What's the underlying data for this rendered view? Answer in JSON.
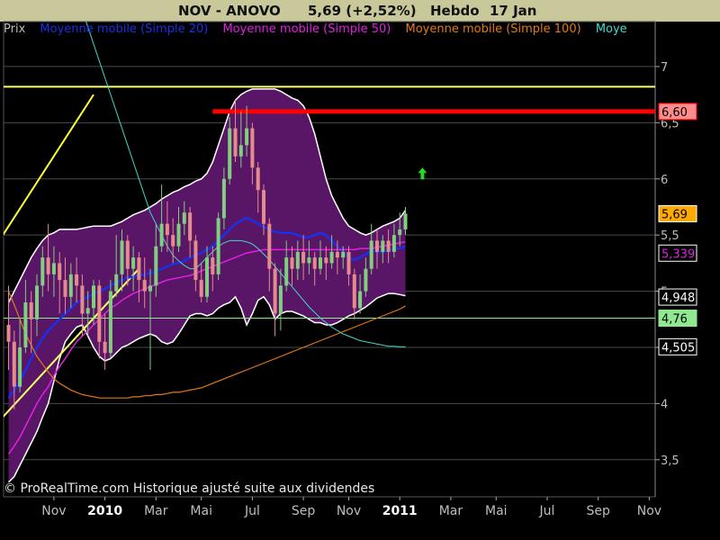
{
  "header": {
    "ticker": "NOV - ANOVO",
    "quote": "5,69 (+2,52%)",
    "period": "Hebdo",
    "date": "17 Jan"
  },
  "legend": [
    {
      "label": "Prix",
      "color": "#bdbdbd"
    },
    {
      "label": "Moyenne mobile (Simple 20)",
      "color": "#1a2fe6"
    },
    {
      "label": "Moyenne mobile (Simple 50)",
      "color": "#e020e0"
    },
    {
      "label": "Moyenne mobile (Simple 100)",
      "color": "#e07818"
    },
    {
      "label": "Moye",
      "color": "#40d8c8"
    }
  ],
  "footnote": "© ProRealTime.com Historique ajusté suite aux dividendes",
  "colors": {
    "background": "#000000",
    "title_bar": "#c8c89a",
    "band_fill": "#5a1666",
    "candle_up": "#7fcf7f",
    "candle_down": "#e48c8c",
    "resistance": "#ff0000",
    "trendline": "#ffff33",
    "support": "#90e890",
    "signal_arrow": "#22dd22"
  },
  "chart_data": {
    "type": "candlestick",
    "x_axis": {
      "labels": [
        {
          "label": "Nov",
          "index": 8,
          "bold": false
        },
        {
          "label": "2010",
          "index": 17,
          "bold": true
        },
        {
          "label": "Mar",
          "index": 26,
          "bold": false
        },
        {
          "label": "Mai",
          "index": 34,
          "bold": false
        },
        {
          "label": "Jul",
          "index": 43,
          "bold": false
        },
        {
          "label": "Sep",
          "index": 52,
          "bold": false
        },
        {
          "label": "Nov",
          "index": 60,
          "bold": false
        },
        {
          "label": "2011",
          "index": 69,
          "bold": true
        },
        {
          "label": "Mar",
          "index": 78,
          "bold": false
        },
        {
          "label": "Mai",
          "index": 86,
          "bold": false
        },
        {
          "label": "Jul",
          "index": 95,
          "bold": false
        },
        {
          "label": "Sep",
          "index": 104,
          "bold": false
        },
        {
          "label": "Nov",
          "index": 113,
          "bold": false
        }
      ]
    },
    "y_axis": {
      "range": [
        3.17,
        7.4
      ],
      "ticks": [
        "7",
        "6,5",
        "6",
        "5,5",
        "5",
        "4,5",
        "4",
        "3,5"
      ],
      "tick_values": [
        7,
        6.5,
        6,
        5.5,
        5,
        4.5,
        4,
        3.5
      ]
    },
    "grid": true,
    "candles": [
      [
        4.7,
        4.55,
        5.05,
        4.3
      ],
      [
        4.55,
        4.15,
        4.65,
        3.95
      ],
      [
        4.15,
        4.5,
        4.75,
        4.1
      ],
      [
        4.5,
        4.9,
        5.1,
        4.45
      ],
      [
        4.9,
        4.75,
        5.0,
        4.45
      ],
      [
        4.75,
        5.05,
        5.15,
        4.6
      ],
      [
        5.05,
        5.3,
        5.4,
        4.95
      ],
      [
        5.3,
        5.15,
        5.6,
        5.0
      ],
      [
        5.15,
        5.25,
        5.4,
        4.95
      ],
      [
        5.25,
        5.1,
        5.35,
        4.8
      ],
      [
        5.1,
        4.95,
        5.3,
        4.8
      ],
      [
        4.95,
        5.15,
        5.25,
        4.85
      ],
      [
        5.15,
        5.05,
        5.3,
        4.9
      ],
      [
        5.05,
        4.8,
        5.15,
        4.6
      ],
      [
        4.8,
        4.85,
        5.0,
        4.6
      ],
      [
        4.85,
        5.05,
        5.1,
        4.7
      ],
      [
        5.05,
        4.55,
        5.1,
        4.4
      ],
      [
        4.55,
        4.45,
        4.8,
        4.3
      ],
      [
        4.45,
        5.0,
        5.1,
        4.4
      ],
      [
        5.0,
        5.15,
        5.5,
        4.95
      ],
      [
        5.15,
        5.45,
        5.55,
        5.0
      ],
      [
        5.45,
        5.2,
        5.5,
        5.05
      ],
      [
        5.2,
        5.3,
        5.4,
        5.0
      ],
      [
        5.3,
        5.1,
        5.35,
        4.9
      ],
      [
        5.1,
        5.0,
        5.3,
        4.85
      ],
      [
        5.0,
        5.05,
        5.2,
        4.3
      ],
      [
        5.05,
        5.4,
        5.6,
        4.95
      ],
      [
        5.4,
        5.6,
        5.95,
        5.35
      ],
      [
        5.6,
        5.5,
        5.8,
        5.35
      ],
      [
        5.5,
        5.4,
        5.65,
        5.25
      ],
      [
        5.4,
        5.6,
        5.75,
        5.35
      ],
      [
        5.6,
        5.7,
        5.8,
        5.5
      ],
      [
        5.7,
        5.45,
        5.75,
        5.3
      ],
      [
        5.45,
        5.1,
        5.5,
        5.0
      ],
      [
        5.1,
        4.95,
        5.25,
        4.9
      ],
      [
        4.95,
        5.3,
        5.4,
        4.9
      ],
      [
        5.3,
        5.15,
        5.4,
        5.0
      ],
      [
        5.15,
        5.65,
        5.7,
        5.1
      ],
      [
        5.65,
        6.0,
        6.1,
        5.55
      ],
      [
        6.0,
        6.45,
        6.55,
        5.95
      ],
      [
        6.45,
        6.2,
        6.7,
        6.15
      ],
      [
        6.2,
        6.3,
        6.6,
        6.1
      ],
      [
        6.3,
        6.45,
        6.65,
        6.2
      ],
      [
        6.45,
        6.1,
        6.5,
        5.95
      ],
      [
        6.1,
        5.9,
        6.15,
        5.7
      ],
      [
        5.9,
        5.6,
        5.95,
        5.5
      ],
      [
        5.6,
        5.2,
        5.65,
        5.0
      ],
      [
        5.2,
        4.8,
        5.25,
        4.6
      ],
      [
        4.8,
        5.05,
        5.2,
        4.65
      ],
      [
        5.05,
        5.3,
        5.45,
        5.0
      ],
      [
        5.3,
        5.2,
        5.4,
        5.05
      ],
      [
        5.2,
        5.35,
        5.45,
        5.1
      ],
      [
        5.35,
        5.25,
        5.5,
        5.1
      ],
      [
        5.25,
        5.3,
        5.45,
        5.15
      ],
      [
        5.3,
        5.2,
        5.35,
        5.05
      ],
      [
        5.2,
        5.3,
        5.45,
        5.15
      ],
      [
        5.3,
        5.25,
        5.4,
        5.1
      ],
      [
        5.25,
        5.35,
        5.5,
        5.2
      ],
      [
        5.35,
        5.3,
        5.45,
        5.15
      ],
      [
        5.3,
        5.35,
        5.4,
        5.2
      ],
      [
        5.35,
        5.15,
        5.4,
        5.05
      ],
      [
        5.15,
        4.85,
        5.2,
        4.75
      ],
      [
        4.85,
        5.0,
        5.15,
        4.8
      ],
      [
        5.0,
        5.2,
        5.3,
        4.95
      ],
      [
        5.2,
        5.45,
        5.6,
        5.15
      ],
      [
        5.45,
        5.35,
        5.55,
        5.2
      ],
      [
        5.35,
        5.45,
        5.5,
        5.25
      ],
      [
        5.45,
        5.35,
        5.55,
        5.25
      ],
      [
        5.35,
        5.5,
        5.6,
        5.3
      ],
      [
        5.5,
        5.55,
        5.7,
        5.4
      ],
      [
        5.55,
        5.69,
        5.75,
        5.5
      ]
    ],
    "series": [
      {
        "name": "Moyenne mobile (Simple 20)",
        "color": "#1a2fe6",
        "width": 2.5,
        "offset": 0,
        "values": [
          4.05,
          4.12,
          4.2,
          4.3,
          4.4,
          4.5,
          4.58,
          4.65,
          4.7,
          4.75,
          4.8,
          4.85,
          4.9,
          4.92,
          4.95,
          4.98,
          5.0,
          5.02,
          5.05,
          5.08,
          5.1,
          5.12,
          5.13,
          5.14,
          5.15,
          5.16,
          5.18,
          5.2,
          5.22,
          5.24,
          5.25,
          5.27,
          5.3,
          5.32,
          5.34,
          5.37,
          5.4,
          5.45,
          5.5,
          5.55,
          5.6,
          5.63,
          5.65,
          5.63,
          5.6,
          5.57,
          5.55,
          5.53,
          5.52,
          5.52,
          5.52,
          5.5,
          5.48,
          5.48,
          5.5,
          5.52,
          5.5,
          5.45,
          5.4,
          5.35,
          5.3,
          5.28,
          5.3,
          5.33,
          5.36,
          5.35,
          5.35,
          5.36,
          5.38,
          5.38,
          5.4
        ]
      },
      {
        "name": "Moyenne mobile (Simple 50)",
        "color": "#e020e0",
        "width": 1.5,
        "offset": 0,
        "values": [
          3.55,
          3.62,
          3.7,
          3.8,
          3.9,
          4.0,
          4.08,
          4.15,
          4.25,
          4.33,
          4.4,
          4.48,
          4.55,
          4.6,
          4.65,
          4.7,
          4.75,
          4.8,
          4.85,
          4.88,
          4.92,
          4.95,
          4.98,
          5.0,
          5.02,
          5.04,
          5.06,
          5.08,
          5.1,
          5.11,
          5.12,
          5.13,
          5.14,
          5.16,
          5.18,
          5.2,
          5.22,
          5.24,
          5.26,
          5.28,
          5.3,
          5.32,
          5.34,
          5.35,
          5.36,
          5.37,
          5.37,
          5.37,
          5.37,
          5.37,
          5.37,
          5.37,
          5.37,
          5.37,
          5.37,
          5.37,
          5.37,
          5.37,
          5.37,
          5.37,
          5.37,
          5.37,
          5.38,
          5.38,
          5.38,
          5.39,
          5.4,
          5.41,
          5.42,
          5.43,
          5.44
        ]
      },
      {
        "name": "Moyenne mobile (Simple 100)",
        "color": "#e07818",
        "width": 1.2,
        "offset": 0,
        "values": [
          5.0,
          4.88,
          4.75,
          4.62,
          4.52,
          4.42,
          4.35,
          4.28,
          4.22,
          4.18,
          4.15,
          4.12,
          4.1,
          4.08,
          4.07,
          4.06,
          4.05,
          4.05,
          4.05,
          4.05,
          4.05,
          4.05,
          4.06,
          4.06,
          4.07,
          4.07,
          4.08,
          4.08,
          4.09,
          4.1,
          4.1,
          4.11,
          4.12,
          4.13,
          4.14,
          4.16,
          4.18,
          4.2,
          4.22,
          4.24,
          4.26,
          4.28,
          4.3,
          4.32,
          4.34,
          4.36,
          4.38,
          4.4,
          4.42,
          4.44,
          4.46,
          4.48,
          4.5,
          4.52,
          4.54,
          4.56,
          4.58,
          4.6,
          4.62,
          4.64,
          4.66,
          4.68,
          4.7,
          4.72,
          4.74,
          4.76,
          4.78,
          4.8,
          4.82,
          4.84,
          4.87
        ]
      },
      {
        "name": "Moye",
        "color": "#40d8c8",
        "width": 1,
        "offset": 0,
        "values": [
          9.9,
          9.7,
          9.5,
          9.3,
          9.1,
          8.9,
          8.7,
          8.5,
          8.3,
          8.1,
          7.95,
          7.8,
          7.65,
          7.5,
          7.35,
          7.2,
          7.05,
          6.9,
          6.75,
          6.6,
          6.45,
          6.3,
          6.15,
          6.0,
          5.85,
          5.7,
          5.6,
          5.5,
          5.4,
          5.32,
          5.27,
          5.23,
          5.2,
          5.2,
          5.25,
          5.3,
          5.35,
          5.4,
          5.43,
          5.45,
          5.45,
          5.45,
          5.44,
          5.42,
          5.38,
          5.33,
          5.28,
          5.22,
          5.16,
          5.1,
          5.04,
          4.98,
          4.92,
          4.86,
          4.81,
          4.76,
          4.72,
          4.68,
          4.65,
          4.62,
          4.6,
          4.58,
          4.56,
          4.55,
          4.54,
          4.53,
          4.52,
          4.51,
          4.51,
          4.505,
          4.505
        ]
      }
    ],
    "bands": {
      "color": "#ffffff",
      "upper": [
        4.9,
        5.0,
        5.1,
        5.2,
        5.3,
        5.38,
        5.45,
        5.5,
        5.52,
        5.55,
        5.55,
        5.55,
        5.55,
        5.56,
        5.57,
        5.58,
        5.58,
        5.58,
        5.58,
        5.6,
        5.62,
        5.65,
        5.68,
        5.7,
        5.72,
        5.75,
        5.78,
        5.82,
        5.85,
        5.88,
        5.9,
        5.93,
        5.95,
        5.98,
        6.0,
        6.05,
        6.15,
        6.3,
        6.45,
        6.6,
        6.7,
        6.75,
        6.78,
        6.8,
        6.8,
        6.8,
        6.8,
        6.8,
        6.78,
        6.75,
        6.72,
        6.7,
        6.65,
        6.55,
        6.4,
        6.2,
        6.0,
        5.85,
        5.75,
        5.65,
        5.58,
        5.55,
        5.52,
        5.5,
        5.52,
        5.55,
        5.58,
        5.6,
        5.62,
        5.65,
        5.72
      ],
      "lower": [
        3.3,
        3.35,
        3.45,
        3.55,
        3.65,
        3.75,
        3.88,
        4.0,
        4.2,
        4.4,
        4.55,
        4.62,
        4.68,
        4.7,
        4.6,
        4.5,
        4.42,
        4.38,
        4.4,
        4.45,
        4.5,
        4.52,
        4.55,
        4.58,
        4.6,
        4.62,
        4.6,
        4.55,
        4.53,
        4.55,
        4.62,
        4.7,
        4.78,
        4.8,
        4.8,
        4.78,
        4.8,
        4.85,
        4.88,
        4.9,
        4.95,
        4.85,
        4.7,
        4.8,
        4.92,
        4.95,
        4.88,
        4.75,
        4.8,
        4.82,
        4.82,
        4.8,
        4.78,
        4.75,
        4.72,
        4.72,
        4.7,
        4.7,
        4.72,
        4.75,
        4.78,
        4.8,
        4.83,
        4.86,
        4.9,
        4.94,
        4.96,
        4.98,
        4.98,
        4.97,
        4.96
      ]
    },
    "levels": [
      {
        "name": "resistance",
        "value": 6.6,
        "label": "6,60",
        "color": "#ff0000",
        "width": 5,
        "from_index": 36
      },
      {
        "name": "top-line",
        "value": 6.82,
        "color": "#ffff66",
        "width": 2,
        "from_index": -1
      },
      {
        "name": "support",
        "value": 4.76,
        "label": "4,76",
        "color": "#90e890",
        "width": 1,
        "from_index": -1
      }
    ],
    "trendlines": [
      {
        "from": [
          -1,
          3.88
        ],
        "to": [
          23,
          5.2
        ],
        "color": "#ffff66",
        "width": 2
      },
      {
        "from": [
          -1,
          5.5
        ],
        "to": [
          15,
          6.75
        ],
        "color": "#ffff33",
        "width": 2
      }
    ],
    "value_badges": [
      {
        "value": 5.69,
        "label": "5,69",
        "bg": "#ffaa00",
        "fg": "#000000",
        "border": "#ffffff"
      },
      {
        "value": 5.339,
        "label": "5,339",
        "bg": "#000000",
        "fg": "#e020e0",
        "border": "#ffffff"
      },
      {
        "value": 4.948,
        "label": "4,948",
        "bg": "#000000",
        "fg": "#ffffff",
        "border": "#ffffff"
      },
      {
        "value": 4.76,
        "label": "4,76",
        "bg": "#90e890",
        "fg": "#000000",
        "border": "#90e890"
      },
      {
        "value": 4.505,
        "label": "4,505",
        "bg": "#000000",
        "fg": "#ffffff",
        "border": "#ffffff"
      },
      {
        "value": 6.6,
        "label": "6,60",
        "bg": "#ff8c8c",
        "fg": "#000000",
        "border": "#ff0000"
      }
    ],
    "signal_arrow": {
      "index": 73,
      "value": 6.1,
      "direction": "up",
      "color": "#22dd22"
    }
  }
}
